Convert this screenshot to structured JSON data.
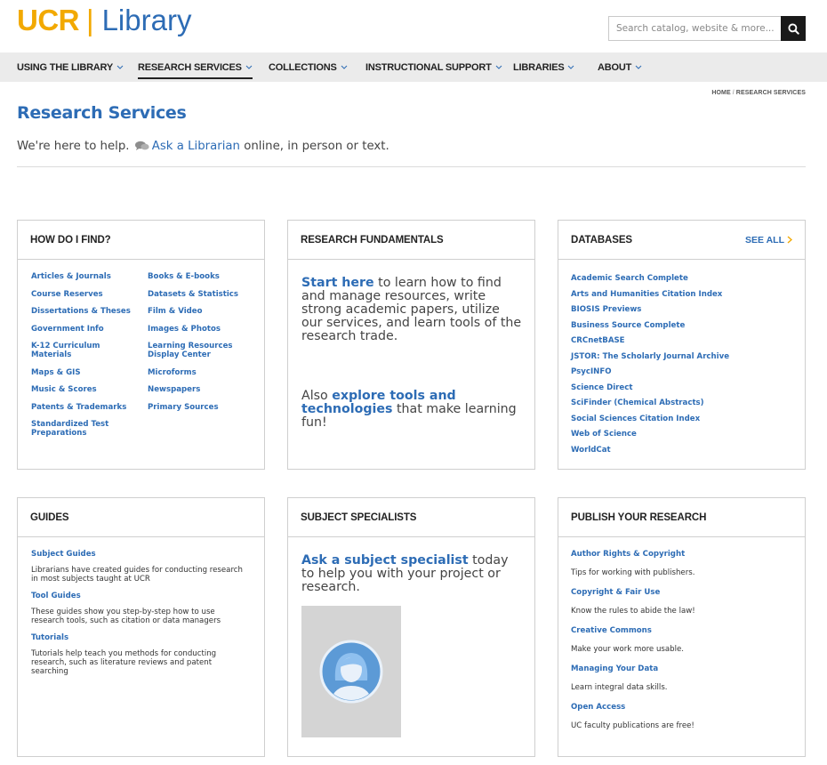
{
  "header": {
    "logo_ucr": "UCR",
    "logo_sep": "|",
    "logo_library": "Library",
    "search_placeholder": "Search catalog, website & more...",
    "search_icon": "search-icon"
  },
  "nav": {
    "items": [
      {
        "label": "USING THE LIBRARY"
      },
      {
        "label": "RESEARCH SERVICES"
      },
      {
        "label": "COLLECTIONS"
      },
      {
        "label": "INSTRUCTIONAL SUPPORT"
      },
      {
        "label": "LIBRARIES"
      },
      {
        "label": "ABOUT"
      }
    ],
    "active": "RESEARCH SERVICES"
  },
  "breadcrumb": {
    "home": "HOME",
    "sep": "/",
    "current": "RESEARCH SERVICES"
  },
  "page": {
    "title": "Research Services",
    "intro_before": "We're here to help.",
    "intro_link": "Ask a Librarian",
    "intro_after": "online, in person or text."
  },
  "how_do_i_find": {
    "title": "HOW DO I FIND?",
    "left": [
      "Articles & Journals",
      "Course Reserves",
      "Dissertations & Theses",
      "Government Info",
      "K-12 Curriculum Materials",
      "Maps & GIS",
      "Music & Scores",
      "Patents & Trademarks",
      "Standardized Test Preparations"
    ],
    "right": [
      "Books & E-books",
      "Datasets & Statistics",
      "Film & Video",
      "Images & Photos",
      "Learning Resources Display Center",
      "Microforms",
      "Newspapers",
      "Primary Sources"
    ]
  },
  "research_fundamentals": {
    "title": "RESEARCH FUNDAMENTALS",
    "p1_link": "Start here",
    "p1_text": "to learn how to find and manage resources, write strong academic papers, utilize our services, and learn tools of the research trade.",
    "p2_before": "Also",
    "p2_link": "explore tools and technologies",
    "p2_after": "that make learning fun!"
  },
  "databases": {
    "title": "DATABASES",
    "see_all": "SEE ALL",
    "items": [
      "Academic Search Complete",
      "Arts and Humanities Citation Index",
      "BIOSIS Previews",
      "Business Source Complete",
      "CRCnetBASE",
      "JSTOR: The Scholarly Journal Archive",
      "PsycINFO",
      "Science Direct",
      "SciFinder (Chemical Abstracts)",
      "Social Sciences Citation Index",
      "Web of Science",
      "WorldCat"
    ]
  },
  "guides": {
    "title": "GUIDES",
    "items": [
      {
        "link": "Subject Guides",
        "desc": "Librarians have created guides for conducting research in most subjects taught at UCR"
      },
      {
        "link": "Tool Guides",
        "desc": "These guides show you step-by-step how to use research tools, such as citation or data managers"
      },
      {
        "link": "Tutorials",
        "desc": "Tutorials help teach you methods for conducting research, such as literature reviews and patent searching"
      }
    ]
  },
  "subject_specialists": {
    "title": "SUBJECT SPECIALISTS",
    "link": "Ask a subject specialist",
    "text": "today to help you with your project or research.",
    "image_icon": "person-avatar-icon"
  },
  "publish": {
    "title": "PUBLISH YOUR RESEARCH",
    "items": [
      {
        "link": "Author Rights & Copyright",
        "desc": "Tips for working with publishers."
      },
      {
        "link": "Copyright & Fair Use",
        "desc": "Know the rules to abide the law!"
      },
      {
        "link": "Creative Commons",
        "desc": "Make your work more usable."
      },
      {
        "link": "Managing Your Data",
        "desc": "Learn integral data skills."
      },
      {
        "link": "Open Access",
        "desc": "UC faculty publications are free!"
      }
    ]
  },
  "colors": {
    "brand_blue": "#2d6cb5",
    "brand_gold": "#f2a900",
    "nav_bg": "#ebebeb"
  }
}
